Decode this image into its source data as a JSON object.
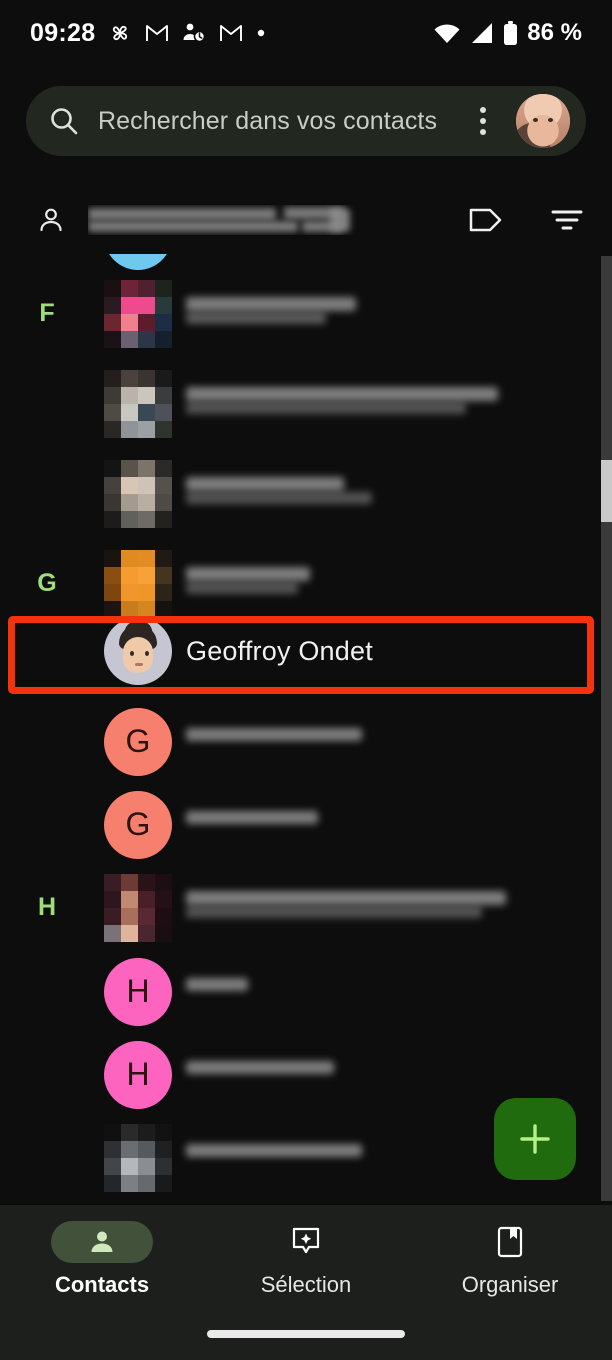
{
  "status_bar": {
    "time": "09:28",
    "battery_text": "86 %",
    "left_icons": [
      "drive-pinwheel-icon",
      "gmail-icon",
      "contacts-sync-icon",
      "gmail-icon",
      "more-dot-icon"
    ],
    "right_icons": [
      "wifi-icon",
      "cellular-signal-icon",
      "battery-icon"
    ]
  },
  "search": {
    "placeholder": "Rechercher dans vos contacts",
    "icon": "search-icon",
    "overflow_icon": "kebab-menu-icon",
    "avatar": "account-avatar"
  },
  "account_row": {
    "person_icon": "person-icon",
    "email_redacted": "",
    "label_icon": "label-tag-icon",
    "filter_icon": "filter-icon"
  },
  "list": {
    "sections": [
      "F",
      "G",
      "H"
    ],
    "highlighted_contact": {
      "name": "Geoffroy Ondet",
      "avatar": "memoji-avatar",
      "highlight_color": "#f4320c"
    },
    "avatar_colors": {
      "g_initial": "#f77f6e",
      "h_initial": "#fd64c0",
      "partial_top": "#6fc8f0"
    },
    "initials": [
      "G",
      "G",
      "H",
      "H"
    ],
    "scrollbar": "vertical-scrollbar"
  },
  "fab": {
    "icon": "plus-icon",
    "background": "#1f6b0e",
    "icon_color": "#b6f089"
  },
  "bottom_nav": {
    "items": [
      {
        "label": "Contacts",
        "icon": "person-filled-icon",
        "active": true
      },
      {
        "label": "Sélection",
        "icon": "sparkle-bubble-icon",
        "active": false
      },
      {
        "label": "Organiser",
        "icon": "bookmark-book-icon",
        "active": false
      }
    ]
  }
}
